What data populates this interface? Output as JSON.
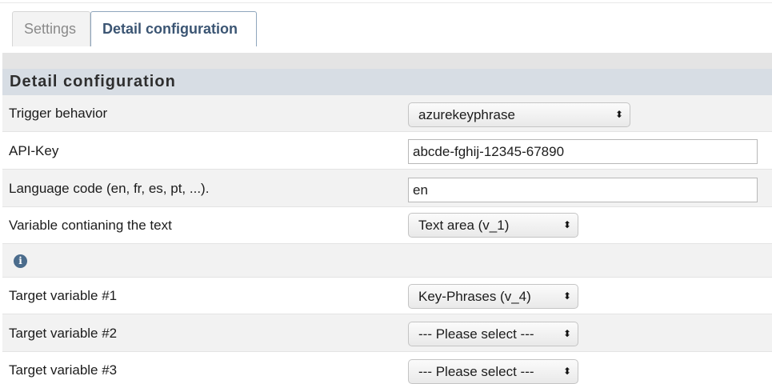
{
  "tabs": [
    {
      "label": "Settings"
    },
    {
      "label": "Detail configuration"
    }
  ],
  "section": {
    "title": "Detail configuration"
  },
  "fields": {
    "trigger_behavior": {
      "label": "Trigger behavior",
      "value": "azurekeyphrase"
    },
    "api_key": {
      "label": "API-Key",
      "value": "abcde-fghij-12345-67890"
    },
    "language_code": {
      "label": "Language code (en, fr, es, pt, ...).",
      "value": "en"
    },
    "text_variable": {
      "label": "Variable contianing the text",
      "value": "Text area (v_1)"
    },
    "target_1": {
      "label": "Target variable #1",
      "value": "Key-Phrases (v_4)"
    },
    "target_2": {
      "label": "Target variable #2",
      "value": "--- Please select ---"
    },
    "target_3": {
      "label": "Target variable #3",
      "value": "--- Please select ---"
    }
  },
  "icons": {
    "info": "info-icon",
    "select_arrows": "updown-arrows-icon"
  }
}
